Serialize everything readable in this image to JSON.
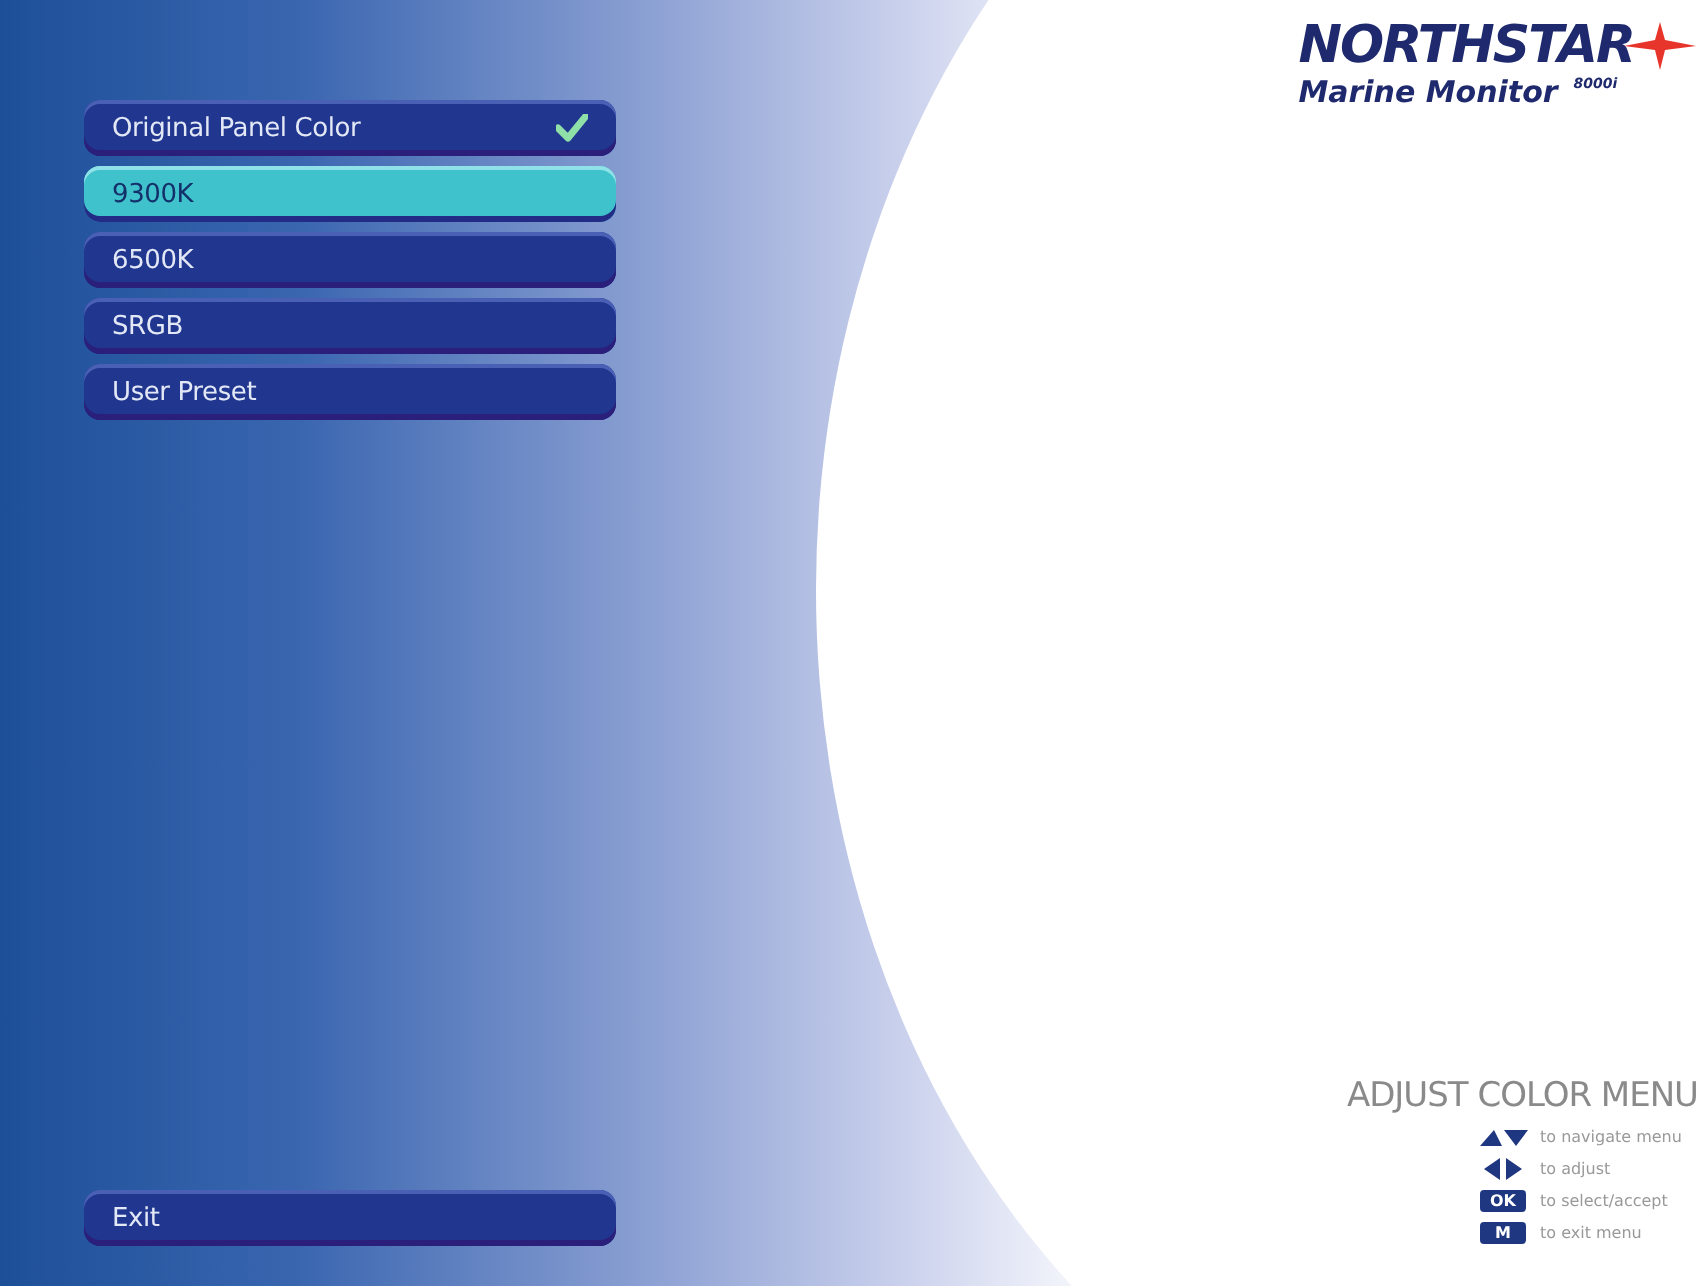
{
  "menu": {
    "items": [
      {
        "label": "Original Panel Color",
        "selected": false,
        "checked": true
      },
      {
        "label": "9300K",
        "selected": true,
        "checked": false
      },
      {
        "label": "6500K",
        "selected": false,
        "checked": false
      },
      {
        "label": "SRGB",
        "selected": false,
        "checked": false
      },
      {
        "label": "User Preset",
        "selected": false,
        "checked": false
      }
    ],
    "exit": "Exit"
  },
  "logo": {
    "brand": "NORTHSTAR",
    "product": "Marine Monitor",
    "model": "8000i"
  },
  "help": {
    "title": "ADJUST COLOR MENU",
    "rows": [
      {
        "kind": "updown",
        "text": "to navigate menu"
      },
      {
        "kind": "leftright",
        "text": "to adjust"
      },
      {
        "kind": "key",
        "key": "OK",
        "text": "to select/accept"
      },
      {
        "kind": "key",
        "key": "M",
        "text": "to exit menu"
      }
    ]
  }
}
